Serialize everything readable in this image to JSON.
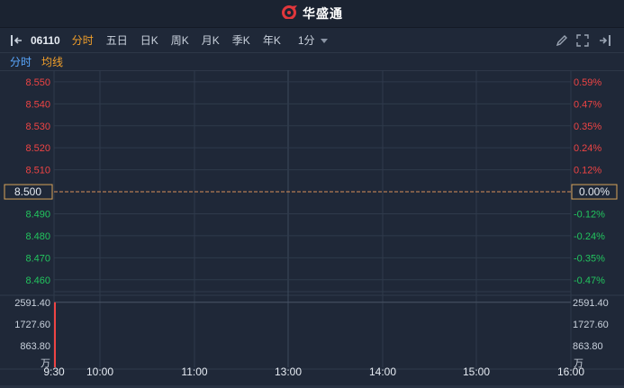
{
  "header": {
    "brand": "华盛通"
  },
  "toolbar": {
    "code": "06110",
    "tabs": [
      {
        "label": "分时",
        "active": true
      },
      {
        "label": "五日"
      },
      {
        "label": "日K"
      },
      {
        "label": "周K"
      },
      {
        "label": "月K"
      },
      {
        "label": "季K"
      },
      {
        "label": "年K"
      }
    ],
    "interval": "1分"
  },
  "sub_tabs": {
    "fenshi": "分时",
    "junxian": "均线"
  },
  "colors": {
    "up": "#ef4444",
    "down": "#22c55e",
    "accent": "#f3a02a",
    "link": "#5aa8ff",
    "background": "#1f2838",
    "grid": "#2f3a4b"
  },
  "chart_data": {
    "type": "line",
    "x_ticks": [
      "9:30",
      "10:00",
      "11:00",
      "13:00",
      "14:00",
      "15:00",
      "16:00"
    ],
    "price": {
      "ylim": [
        8.455,
        8.552
      ],
      "ref": 8.5,
      "ref_label": "8.500",
      "ref_pct": "0.00%",
      "up_ticks": [
        {
          "value": 8.55,
          "label": "8.550",
          "pct": "0.59%"
        },
        {
          "value": 8.54,
          "label": "8.540",
          "pct": "0.47%"
        },
        {
          "value": 8.53,
          "label": "8.530",
          "pct": "0.35%"
        },
        {
          "value": 8.52,
          "label": "8.520",
          "pct": "0.24%"
        },
        {
          "value": 8.51,
          "label": "8.510",
          "pct": "0.12%"
        }
      ],
      "down_ticks": [
        {
          "value": 8.49,
          "label": "8.490",
          "pct": "-0.12%"
        },
        {
          "value": 8.48,
          "label": "8.480",
          "pct": "-0.24%"
        },
        {
          "value": 8.47,
          "label": "8.470",
          "pct": "-0.35%"
        },
        {
          "value": 8.46,
          "label": "8.460",
          "pct": "-0.47%"
        }
      ],
      "series": [
        {
          "x": [
            "9:30",
            "16:00"
          ],
          "y": [
            8.5,
            8.5
          ]
        }
      ]
    },
    "volume": {
      "ylim": [
        0,
        2800
      ],
      "ticks": [
        {
          "value": 2591.4,
          "label": "2591.40"
        },
        {
          "value": 1727.6,
          "label": "1727.60"
        },
        {
          "value": 863.8,
          "label": "863.80"
        }
      ],
      "unit": "万",
      "bars": [
        {
          "x": "9:30",
          "value": 2591.4
        }
      ]
    }
  }
}
